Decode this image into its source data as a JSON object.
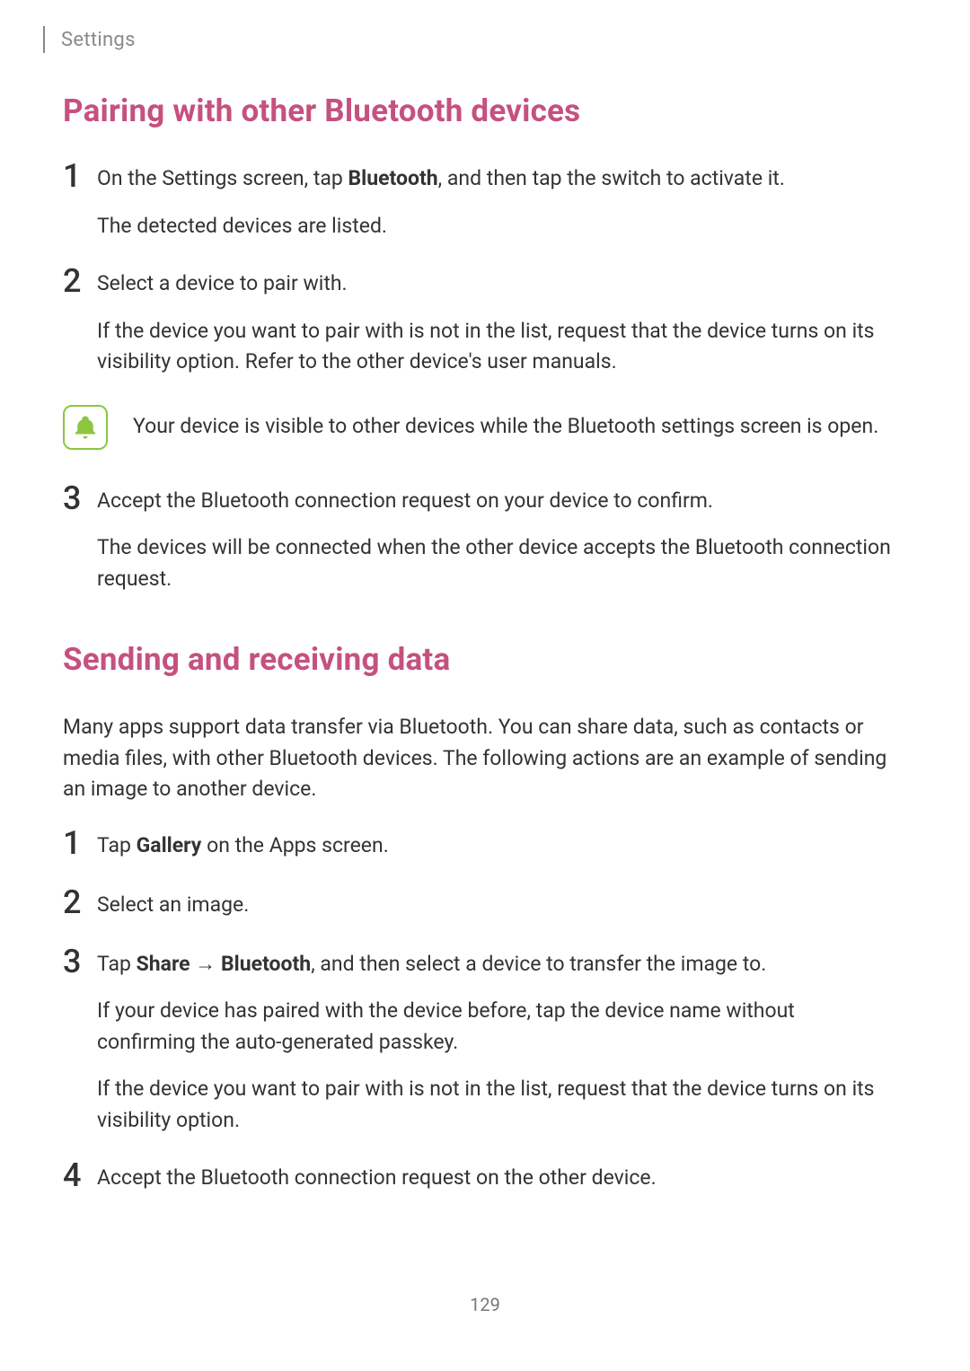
{
  "header": {
    "section_label": "Settings"
  },
  "page_number": "129",
  "section1": {
    "title": "Pairing with other Bluetooth devices",
    "steps": [
      {
        "num": "1",
        "line1_pre": "On the Settings screen, tap ",
        "line1_bold": "Bluetooth",
        "line1_post": ", and then tap the switch to activate it.",
        "line2": "The detected devices are listed."
      },
      {
        "num": "2",
        "line1": "Select a device to pair with.",
        "line2": "If the device you want to pair with is not in the list, request that the device turns on its visibility option. Refer to the other device's user manuals."
      },
      {
        "num": "3",
        "line1": "Accept the Bluetooth connection request on your device to confirm.",
        "line2": "The devices will be connected when the other device accepts the Bluetooth connection request."
      }
    ],
    "note": "Your device is visible to other devices while the Bluetooth settings screen is open."
  },
  "section2": {
    "title": "Sending and receiving data",
    "intro": "Many apps support data transfer via Bluetooth. You can share data, such as contacts or media files, with other Bluetooth devices. The following actions are an example of sending an image to another device.",
    "steps": [
      {
        "num": "1",
        "pre": "Tap ",
        "bold": "Gallery",
        "post": " on the Apps screen."
      },
      {
        "num": "2",
        "line1": "Select an image."
      },
      {
        "num": "3",
        "pre": "Tap ",
        "bold1": "Share",
        "arrow": " → ",
        "bold2": "Bluetooth",
        "post": ", and then select a device to transfer the image to.",
        "p2": "If your device has paired with the device before, tap the device name without confirming the auto-generated passkey.",
        "p3": "If the device you want to pair with is not in the list, request that the device turns on its visibility option."
      },
      {
        "num": "4",
        "line1": "Accept the Bluetooth connection request on the other device."
      }
    ]
  }
}
